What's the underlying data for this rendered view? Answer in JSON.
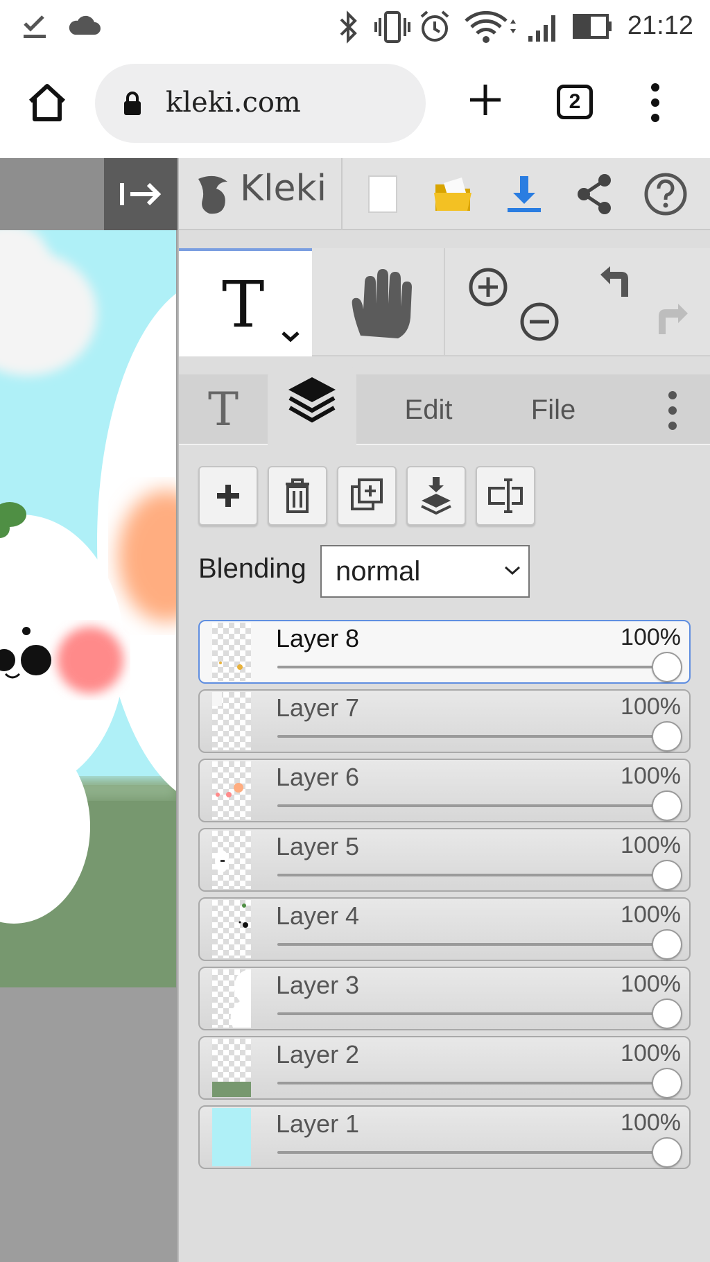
{
  "status_bar": {
    "time": "21:12",
    "icons": [
      "download-done-icon",
      "cloud-icon",
      "bluetooth-icon",
      "vibrate-icon",
      "alarm-icon",
      "wifi-icon",
      "signal-icon",
      "battery-icon"
    ]
  },
  "browser": {
    "url": "kleki.com",
    "tab_count": "2"
  },
  "app": {
    "logo_text": "Kleki",
    "top_icons": [
      "new-image-icon",
      "open-folder-icon",
      "download-icon",
      "share-icon",
      "help-icon"
    ],
    "accent_color": "#2a7de1"
  },
  "tools": {
    "text_tool_glyph": "T",
    "items": [
      "text-tool",
      "hand-tool",
      "zoom-in",
      "zoom-out",
      "undo",
      "redo"
    ]
  },
  "tabs": {
    "text_tab_glyph": "T",
    "edit": "Edit",
    "file": "File"
  },
  "layer_actions": [
    "add-layer",
    "delete-layer",
    "duplicate-layer",
    "merge-down",
    "rename-layer"
  ],
  "blending": {
    "label": "Blending",
    "value": "normal"
  },
  "layers": [
    {
      "name": "Layer 8",
      "opacity": "100%",
      "opacity_value": 1.0,
      "active": true
    },
    {
      "name": "Layer 7",
      "opacity": "100%",
      "opacity_value": 1.0,
      "active": false
    },
    {
      "name": "Layer 6",
      "opacity": "100%",
      "opacity_value": 1.0,
      "active": false
    },
    {
      "name": "Layer 5",
      "opacity": "100%",
      "opacity_value": 1.0,
      "active": false
    },
    {
      "name": "Layer 4",
      "opacity": "100%",
      "opacity_value": 1.0,
      "active": false
    },
    {
      "name": "Layer 3",
      "opacity": "100%",
      "opacity_value": 1.0,
      "active": false
    },
    {
      "name": "Layer 2",
      "opacity": "100%",
      "opacity_value": 1.0,
      "active": false
    },
    {
      "name": "Layer 1",
      "opacity": "100%",
      "opacity_value": 1.0,
      "active": false
    }
  ]
}
